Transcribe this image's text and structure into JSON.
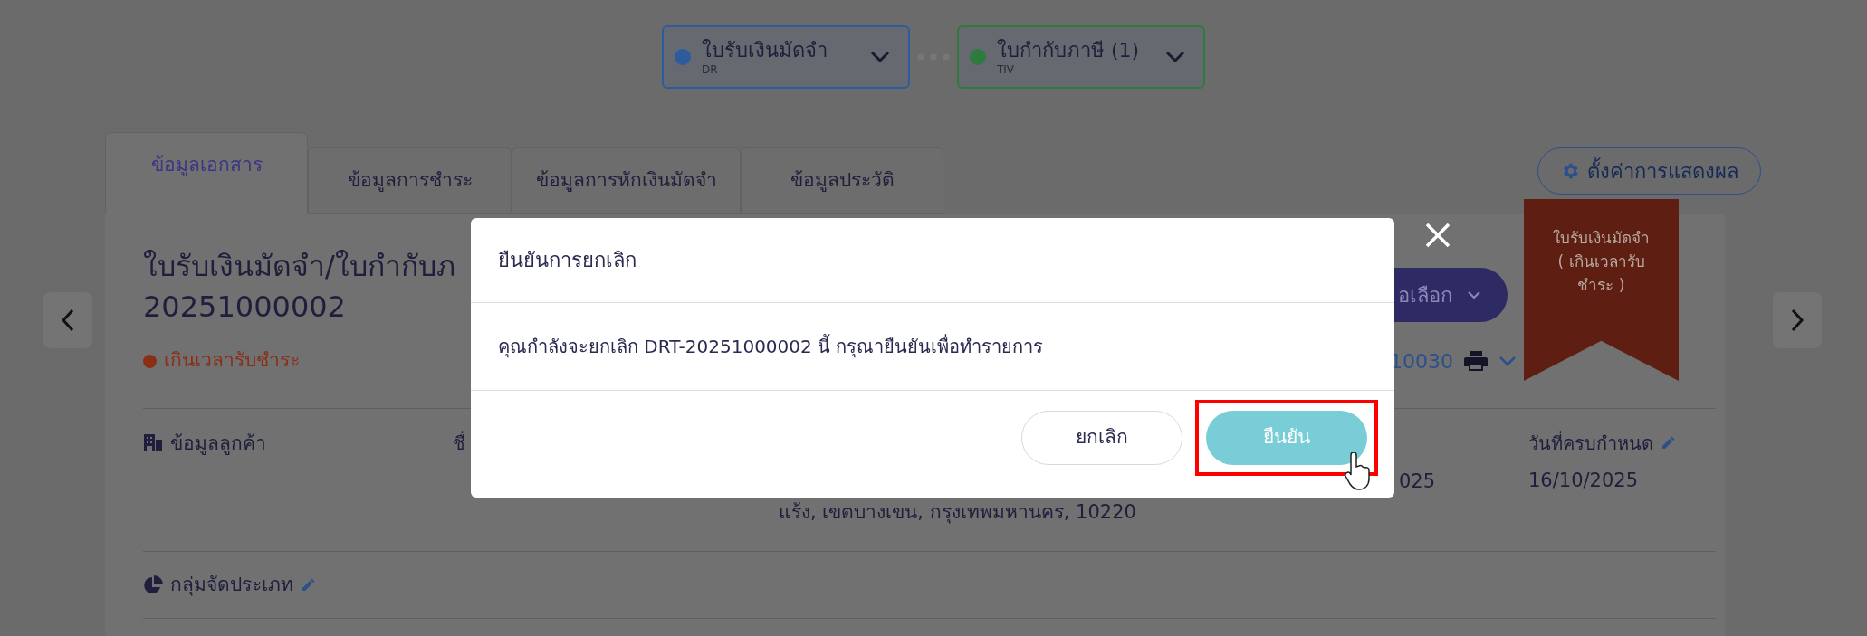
{
  "flow_chips": [
    {
      "title": "ใบรับเงินมัดจำ",
      "code": "DR",
      "color": "#2d5b9e"
    },
    {
      "title": "ใบกำกับภาษี (1)",
      "code": "TIV",
      "color": "#2f7a3f"
    }
  ],
  "tabs": [
    {
      "label": "ข้อมูลเอกสาร",
      "selected": true
    },
    {
      "label": "ข้อมูลการชำระ",
      "selected": false
    },
    {
      "label": "ข้อมูลการหักเงินมัดจำ",
      "selected": false
    },
    {
      "label": "ข้อมูลประวัติ",
      "selected": false
    }
  ],
  "settings_button": "ตั้งค่าการแสดงผล",
  "document": {
    "title_lines": [
      "ใบรับเงินมัดจำ/ใบกำกับภ",
      "20251000002"
    ],
    "status": "เกินเวลารับชำระ",
    "options_button": "อเลือก",
    "reference": "10030"
  },
  "ribbon": {
    "lines": [
      "ใบรับเงินมัดจำ",
      "( เกินเวลารับ",
      "ชำระ )"
    ]
  },
  "customer_section": {
    "heading": "ข้อมูลลูกค้า",
    "name_label": "ชื่",
    "address_line": "แร้ง, เขตบางเขน, กรุงเทพมหานคร, 10220",
    "date_fragment": "025",
    "due_label": "วันที่ครบกำหนด",
    "due_date": "16/10/2025"
  },
  "classification": {
    "heading": "กลุ่มจัดประเภท"
  },
  "dialog": {
    "title": "ยืนยันการยกเลิก",
    "message": "คุณกำลังจะยกเลิก DRT-20251000002 นี้ กรุณายืนยันเพื่อทำรายการ",
    "buttons": [
      {
        "label": "ยกเลิก",
        "kind": "secondary",
        "highlighted": false
      },
      {
        "label": "ยืนยัน",
        "kind": "primary",
        "highlighted": true
      }
    ]
  }
}
